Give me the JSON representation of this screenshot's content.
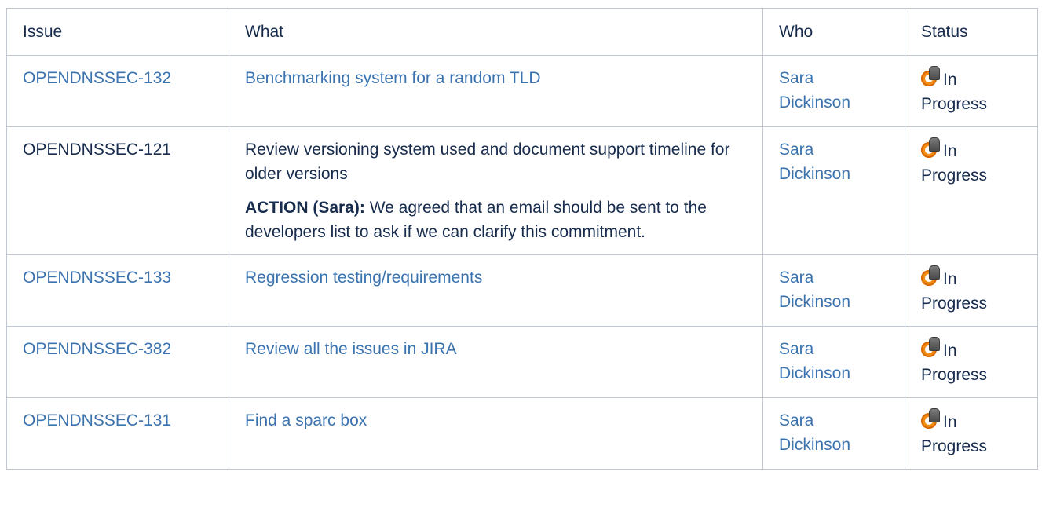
{
  "headers": {
    "issue": "Issue",
    "what": "What",
    "who": "Who",
    "status": "Status"
  },
  "rows": [
    {
      "issue": "OPENDNSSEC-132",
      "what": "Benchmarking system for a random TLD",
      "who_first": "Sara",
      "who_last": "Dickinson",
      "status_first": "In",
      "status_last": "Progress"
    },
    {
      "issue": "OPENDNSSEC-121",
      "what": "Review versioning system used and document support timeline for older versions",
      "action_label": "ACTION (Sara):",
      "action_text": " We agreed that an email should be sent to the developers list to ask if we can clarify this commitment.",
      "who_first": "Sara",
      "who_last": "Dickinson",
      "status_first": "In",
      "status_last": "Progress"
    },
    {
      "issue": "OPENDNSSEC-133",
      "what": "Regression testing/requirements",
      "who_first": "Sara",
      "who_last": "Dickinson",
      "status_first": "In",
      "status_last": "Progress"
    },
    {
      "issue": "OPENDNSSEC-382",
      "what": "Review all the issues in JIRA",
      "who_first": "Sara",
      "who_last": "Dickinson",
      "status_first": "In",
      "status_last": "Progress"
    },
    {
      "issue": "OPENDNSSEC-131",
      "what": "Find a sparc box",
      "who_first": "Sara",
      "who_last": "Dickinson",
      "status_first": "In",
      "status_last": "Progress"
    }
  ],
  "icons": {
    "status": "in-progress-icon"
  },
  "colors": {
    "link": "#3b73af",
    "text": "#172b4d",
    "border": "#c1c7d0",
    "status_icon": "#f28c13"
  }
}
